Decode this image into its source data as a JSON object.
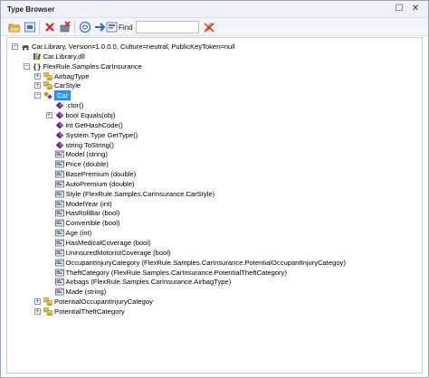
{
  "window": {
    "title": "Type Browser",
    "maximize_glyph": "☐",
    "close_glyph": "✕"
  },
  "toolbar": {
    "find_label": "Find",
    "find_value": "",
    "icons": [
      "open-folder-icon",
      "open-assembly-icon",
      "delete-icon",
      "remove-assembly-icon",
      "web-icon",
      "navigate-forward-icon",
      "find-icon",
      "clear-search-icon"
    ]
  },
  "colors": {
    "selection": "#3399ff",
    "class_icon": "#8e44ad",
    "method_icon": "#6a0dad",
    "enum_icon": "#c8a000",
    "property_icon": "#3b4a63"
  },
  "tree": {
    "nodes": [
      {
        "text": "Car.Library, Version=1.0.0.0, Culture=neutral, PublicKeyToken=null",
        "icon": "assembly-icon",
        "expander": "−"
      },
      {
        "text": "Car.Library.dll",
        "icon": "dll-icon",
        "expander": ""
      },
      {
        "text": "FlexRule.Samples.CarInsurance",
        "icon": "namespace-icon",
        "expander": "−"
      },
      {
        "text": "AirbagType",
        "icon": "enum-icon",
        "expander": "+"
      },
      {
        "text": "CarStyle",
        "icon": "enum-icon",
        "expander": "+"
      },
      {
        "text": "Car",
        "icon": "class-icon",
        "expander": "−"
      },
      {
        "text": ".ctor()",
        "icon": "method-icon",
        "expander": ""
      },
      {
        "text": "bool Equals(obj)",
        "icon": "method-icon",
        "expander": "+"
      },
      {
        "text": "int GetHashCode()",
        "icon": "method-icon",
        "expander": ""
      },
      {
        "text": "System.Type GetType()",
        "icon": "method-icon",
        "expander": ""
      },
      {
        "text": "string ToString()",
        "icon": "method-icon",
        "expander": ""
      },
      {
        "text": "Model (string)",
        "icon": "property-icon",
        "expander": ""
      },
      {
        "text": "Price (double)",
        "icon": "property-icon",
        "expander": ""
      },
      {
        "text": "BasePremium (double)",
        "icon": "property-icon",
        "expander": ""
      },
      {
        "text": "AutoPremium (double)",
        "icon": "property-icon",
        "expander": ""
      },
      {
        "text": "Style (FlexRule.Samples.CarInsurance.CarStyle)",
        "icon": "property-icon",
        "expander": ""
      },
      {
        "text": "ModelYear (int)",
        "icon": "property-icon",
        "expander": ""
      },
      {
        "text": "HasRollBar (bool)",
        "icon": "property-icon",
        "expander": ""
      },
      {
        "text": "Convertible (bool)",
        "icon": "property-icon",
        "expander": ""
      },
      {
        "text": "Age (int)",
        "icon": "property-icon",
        "expander": ""
      },
      {
        "text": "HasMedicalCoverage (bool)",
        "icon": "property-icon",
        "expander": ""
      },
      {
        "text": "UninsuredMotoristCoverage (bool)",
        "icon": "property-icon",
        "expander": ""
      },
      {
        "text": "OccupantInjuryCategory (FlexRule.Samples.CarInsurance.PotentialOccupantInjuryCategoy)",
        "icon": "property-icon",
        "expander": ""
      },
      {
        "text": "TheftCategory (FlexRule.Samples.CarInsurance.PotentialTheftCategory)",
        "icon": "property-icon",
        "expander": ""
      },
      {
        "text": "Airbags (FlexRule.Samples.CarInsurance.AirbagType)",
        "icon": "property-icon",
        "expander": ""
      },
      {
        "text": "Made (string)",
        "icon": "property-icon",
        "expander": ""
      },
      {
        "text": "PotentialOccupantInjuryCategoy",
        "icon": "enum-icon",
        "expander": "+"
      },
      {
        "text": "PotentialTheftCategory",
        "icon": "enum-icon",
        "expander": "+"
      }
    ]
  }
}
